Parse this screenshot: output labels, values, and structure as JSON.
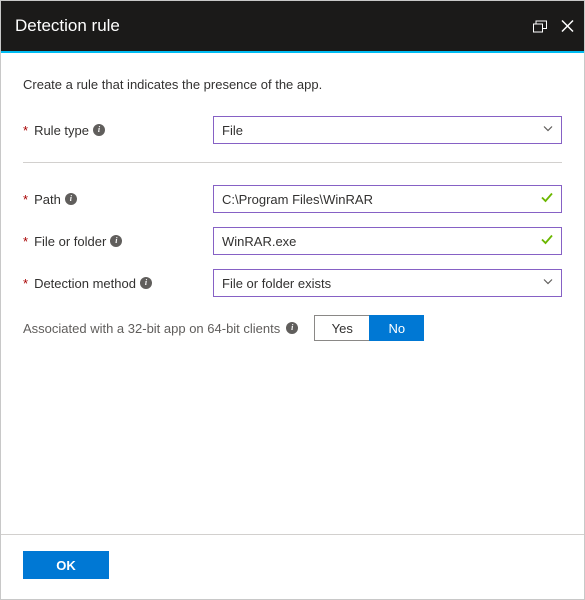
{
  "title": "Detection rule",
  "description": "Create a rule that indicates the presence of the app.",
  "fields": {
    "ruleType": {
      "label": "Rule type",
      "value": "File"
    },
    "path": {
      "label": "Path",
      "value": "C:\\Program Files\\WinRAR"
    },
    "fileOrFolder": {
      "label": "File or folder",
      "value": "WinRAR.exe"
    },
    "detectionMethod": {
      "label": "Detection method",
      "value": "File or folder exists"
    }
  },
  "associated": {
    "label": "Associated with a 32-bit app on 64-bit clients",
    "yes": "Yes",
    "no": "No",
    "selected": "No"
  },
  "buttons": {
    "ok": "OK"
  }
}
